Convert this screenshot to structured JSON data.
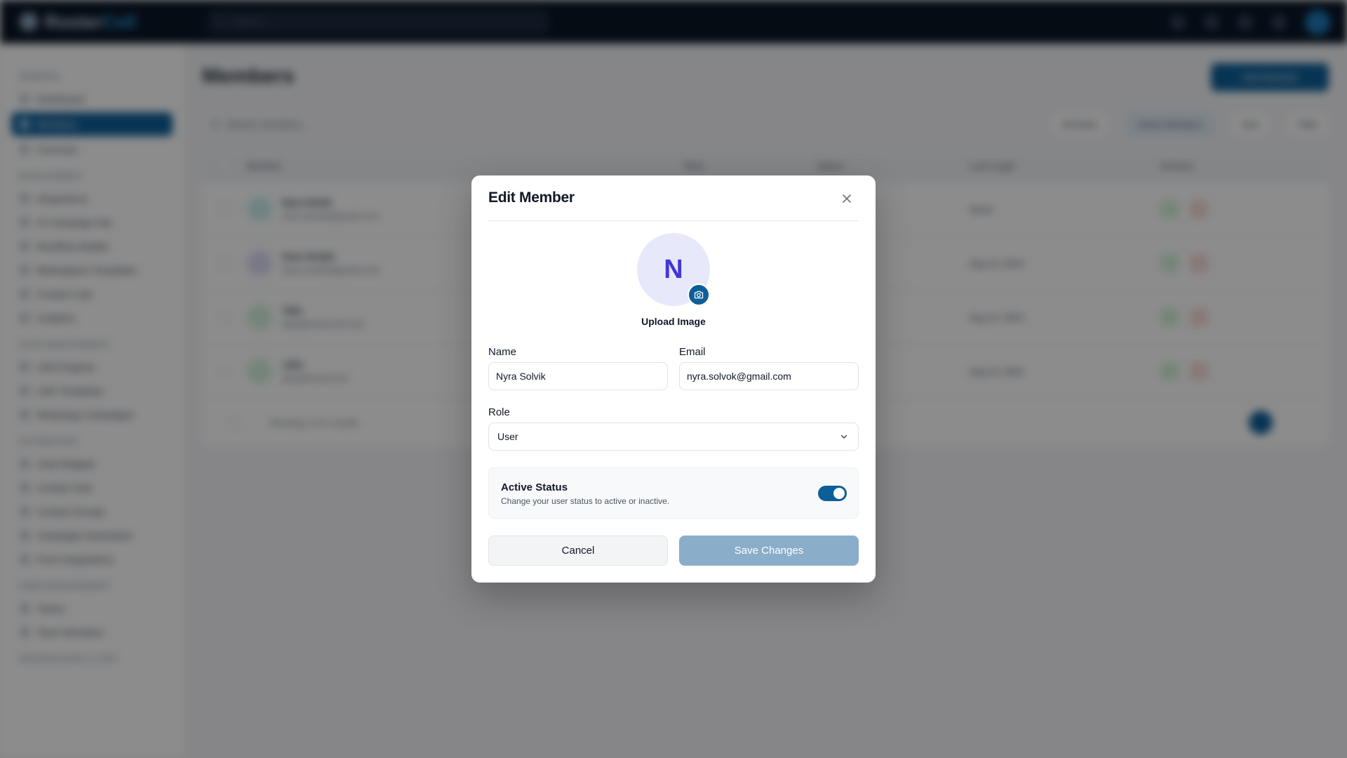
{
  "background": {
    "brand": {
      "name_prefix": "Roster",
      "name_suffix": "Cell"
    },
    "search_placeholder": "Search...",
    "sidebar": {
      "sections": [
        {
          "title": "GENERAL",
          "items": [
            {
              "label": "Dashboard",
              "active": false
            },
            {
              "label": "Members",
              "active": true
            },
            {
              "label": "Overview",
              "active": false
            }
          ]
        },
        {
          "title": "MANAGEMENT",
          "items": [
            {
              "label": "Integrations",
              "active": false
            },
            {
              "label": "AI Campaign Kits",
              "active": false
            },
            {
              "label": "Workflow Builder",
              "active": false
            },
            {
              "label": "Marketplace Templates",
              "active": false
            },
            {
              "label": "Contact Lists",
              "active": false
            },
            {
              "label": "Analytics",
              "active": false
            }
          ]
        },
        {
          "title": "LEAD MANAGEMENT",
          "items": [
            {
              "label": "LMS Engines",
              "active": false
            },
            {
              "label": "LMS Templates",
              "active": false
            },
            {
              "label": "WhatsApp Campaigns",
              "active": false
            }
          ]
        },
        {
          "title": "AUTOMATION",
          "items": [
            {
              "label": "Chat Widgets",
              "active": false
            },
            {
              "label": "Contact Sets",
              "active": false
            },
            {
              "label": "Contact Groups",
              "active": false
            },
            {
              "label": "Campaign Automation",
              "active": false
            },
            {
              "label": "Form Integrations",
              "active": false
            }
          ]
        },
        {
          "title": "USER MANAGEMENT",
          "items": [
            {
              "label": "Teams",
              "active": false
            },
            {
              "label": "Team Members",
              "active": false
            }
          ]
        },
        {
          "title": "INTEGRATIONS & APIS",
          "items": []
        }
      ]
    },
    "page_title": "Members",
    "add_button": "Add Member",
    "table_search_placeholder": "Search members...",
    "toolbar": [
      "All Roles",
      "Active Members",
      "Sort",
      "Filter"
    ],
    "table": {
      "headers": [
        "Member",
        "Role",
        "Status",
        "Last Login",
        "Actions"
      ],
      "rows": [
        {
          "name": "Nyra Solvik",
          "email": "nyra.solvok@gmail.com",
          "role": "",
          "status": "",
          "date": "Never",
          "avatar_color": "#cdeff0"
        },
        {
          "name": "Kara Vendel",
          "email": "kara.vendel@gmail.com",
          "role": "",
          "status": "",
          "date": "Aug 14, 2024",
          "avatar_color": "#dcdcf7"
        },
        {
          "name": "Talia",
          "email": "talia@rostercell.com",
          "role": "",
          "status": "",
          "date": "Aug 12, 2024",
          "avatar_color": "#d4f2dc"
        },
        {
          "name": "Julia",
          "email": "julia@email.com",
          "role": "",
          "status": "",
          "date": "Aug 10, 2024",
          "avatar_color": "#d4f2dc"
        }
      ],
      "footer_text": "Showing 4 of 4 results"
    }
  },
  "modal": {
    "title": "Edit Member",
    "avatar_initial": "N",
    "upload_label": "Upload Image",
    "name_label": "Name",
    "name_value": "Nyra Solvik",
    "email_label": "Email",
    "email_value": "nyra.solvok@gmail.com",
    "role_label": "Role",
    "role_value": "User",
    "status_title": "Active Status",
    "status_desc": "Change your user status to active or inactive.",
    "status_active": true,
    "cancel_label": "Cancel",
    "save_label": "Save Changes"
  },
  "colors": {
    "primary": "#0e5f99",
    "avatar_bg": "#e7e9fb",
    "avatar_text": "#4336d6",
    "save_disabled": "#8aaec9"
  }
}
